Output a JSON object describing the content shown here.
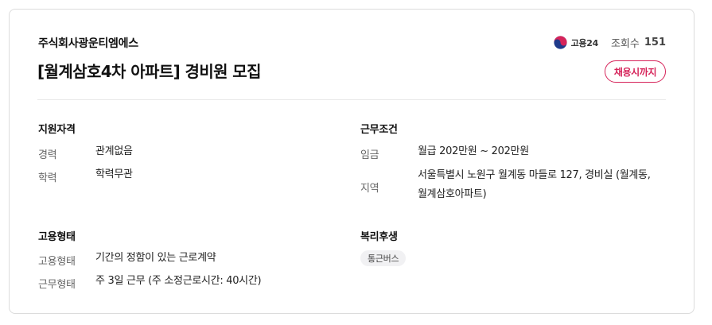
{
  "header": {
    "company": "주식회사광운티엠에스",
    "title": "[월계삼호4차 아파트] 경비원 모집",
    "source_logo_text": "고용24",
    "views_label": "조회수",
    "views_count": "151",
    "deadline_label": "채용시까지"
  },
  "qualification": {
    "title": "지원자격",
    "rows": [
      {
        "label": "경력",
        "value": "관계없음"
      },
      {
        "label": "학력",
        "value": "학력무관"
      }
    ]
  },
  "conditions": {
    "title": "근무조건",
    "rows": [
      {
        "label": "임금",
        "value": "월급 202만원 ~ 202만원"
      },
      {
        "label": "지역",
        "value_line1": "서울특별시 노원구 월계동 마들로 127, 경비실 (월계동,",
        "value_line2": "월계삼호아파트)"
      }
    ]
  },
  "employment": {
    "title": "고용형태",
    "rows": [
      {
        "label": "고용형태",
        "value": "기간의 정함이 있는 근로계약"
      },
      {
        "label": "근무형태",
        "value": "주 3일 근무 (주 소정근로시간: 40시간)"
      }
    ]
  },
  "welfare": {
    "title": "복리후생",
    "tags": [
      "통근버스"
    ]
  },
  "colors": {
    "accent": "#d6245a",
    "divider": "#e8e8e8",
    "tag_bg": "#f1f1f3"
  }
}
